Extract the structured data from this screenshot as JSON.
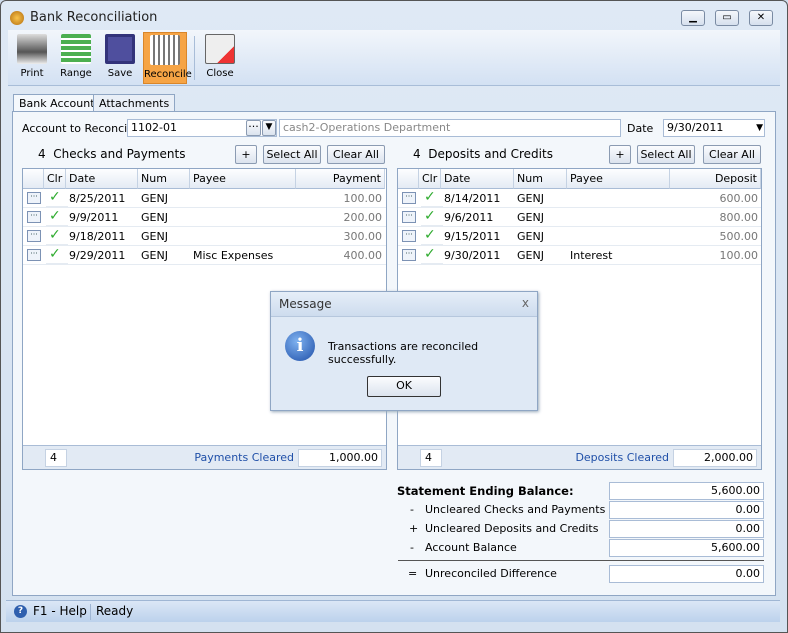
{
  "window": {
    "title": "Bank Reconciliation"
  },
  "toolbar": [
    {
      "label": "Print",
      "icon": "printer-icon"
    },
    {
      "label": "Range",
      "icon": "range-icon"
    },
    {
      "label": "Save",
      "icon": "floppy-icon"
    },
    {
      "label": "Reconcile",
      "icon": "bank-icon",
      "active": true
    },
    {
      "label": "Close",
      "icon": "close-doc-icon"
    }
  ],
  "tabs": [
    "Bank Accounts",
    "Attachments"
  ],
  "account": {
    "label": "Account to Reconcile",
    "value": "1102-01",
    "description": "cash2-Operations Department",
    "date_label": "Date",
    "date": "9/30/2011"
  },
  "payments": {
    "count": "4",
    "title": "Checks and Payments",
    "add": "+",
    "select_all": "Select All",
    "clear_all": "Clear All",
    "columns": [
      "Clr",
      "Date",
      "Num",
      "Payee",
      "Payment"
    ],
    "rows": [
      {
        "date": "8/25/2011",
        "num": "GENJ",
        "payee": "",
        "amount": "100.00"
      },
      {
        "date": "9/9/2011",
        "num": "GENJ",
        "payee": "",
        "amount": "200.00"
      },
      {
        "date": "9/18/2011",
        "num": "GENJ",
        "payee": "",
        "amount": "300.00"
      },
      {
        "date": "9/29/2011",
        "num": "GENJ",
        "payee": "Misc Expenses",
        "amount": "400.00"
      }
    ],
    "footer_count": "4",
    "footer_label": "Payments Cleared",
    "footer_value": "1,000.00"
  },
  "deposits": {
    "count": "4",
    "title": "Deposits and Credits",
    "add": "+",
    "select_all": "Select All",
    "clear_all": "Clear All",
    "columns": [
      "Clr",
      "Date",
      "Num",
      "Payee",
      "Deposit"
    ],
    "rows": [
      {
        "date": "8/14/2011",
        "num": "GENJ",
        "payee": "",
        "amount": "600.00"
      },
      {
        "date": "9/6/2011",
        "num": "GENJ",
        "payee": "",
        "amount": "800.00"
      },
      {
        "date": "9/15/2011",
        "num": "GENJ",
        "payee": "",
        "amount": "500.00"
      },
      {
        "date": "9/30/2011",
        "num": "GENJ",
        "payee": "Interest",
        "amount": "100.00"
      }
    ],
    "footer_count": "4",
    "footer_label": "Deposits Cleared",
    "footer_value": "2,000.00"
  },
  "summary": {
    "title": "Statement Ending Balance:",
    "ending": "5,600.00",
    "lines": [
      {
        "sign": "-",
        "label": "Uncleared Checks and Payments",
        "value": "0.00"
      },
      {
        "sign": "+",
        "label": "Uncleared Deposits and Credits",
        "value": "0.00"
      },
      {
        "sign": "-",
        "label": "Account Balance",
        "value": "5,600.00"
      }
    ],
    "diff_sign": "=",
    "diff_label": "Unreconciled Difference",
    "diff_value": "0.00"
  },
  "dialog": {
    "title": "Message",
    "close": "x",
    "message": "Transactions are reconciled successfully.",
    "ok": "OK"
  },
  "status": {
    "help": "F1 - Help",
    "state": "Ready"
  }
}
